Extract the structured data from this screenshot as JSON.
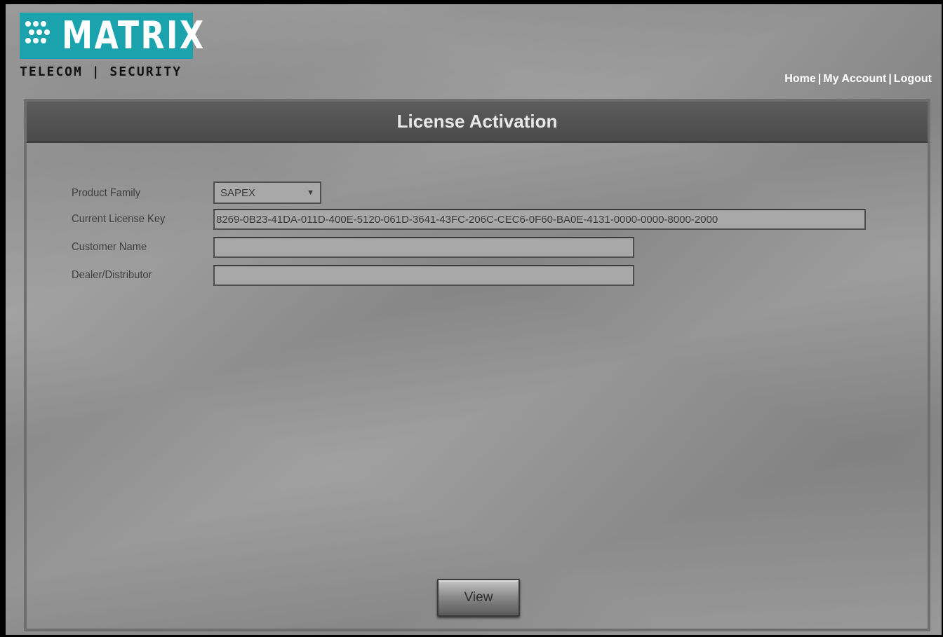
{
  "brand": {
    "name": "MATRIX",
    "tagline": "TELECOM | SECURITY",
    "accent_color": "#1aa3ad"
  },
  "nav": {
    "home": "Home",
    "my_account": "My Account",
    "logout": "Logout",
    "separator": "|"
  },
  "panel": {
    "title": "License Activation"
  },
  "form": {
    "product_family": {
      "label": "Product Family",
      "value": "SAPEX",
      "icon": "chevron-down-icon"
    },
    "current_license_key": {
      "label": "Current License Key",
      "value": "8269-0B23-41DA-011D-400E-5120-061D-3641-43FC-206C-CEC6-0F60-BA0E-4131-0000-0000-8000-2000"
    },
    "customer_name": {
      "label": "Customer Name",
      "value": ""
    },
    "dealer_distributor": {
      "label": "Dealer/Distributor",
      "value": ""
    }
  },
  "actions": {
    "view_label": "View"
  }
}
